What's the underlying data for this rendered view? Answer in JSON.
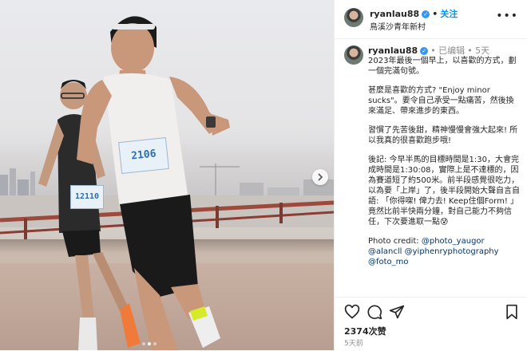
{
  "post_header": {
    "username": "ryanlau88",
    "verified_icon": "verified-badge-icon",
    "separator": "•",
    "follow_label": "关注",
    "location": "鳥溪沙青年新村",
    "more_icon": "more-options-icon"
  },
  "photo": {
    "bib_main": "2106",
    "bib_second": "12110",
    "next_icon": "chevron-right-icon",
    "carousel": {
      "count": 3,
      "active_index": 1
    }
  },
  "caption": {
    "username": "ryanlau88",
    "edited_label": "• 已编辑",
    "time": "• 5天",
    "paragraphs": [
      "2023年最後一個早上，以喜歡的方式，劃一個完滿句號。",
      "甚麼是喜歡的方式? \"Enjoy minor sucks\"。要令自己承受一點痛苦，然後換來滿足、帶來進步的東西。",
      "習慣了先苦後甜，精神慢慢會強大起來! 所以我真的很喜歡跑步哦!",
      "後記: 今早半馬的目標時間是1:30，大會完成時間是1:30:08，實際上是不達標的，因為賽道短了約500米。前半段感覺很吃力，以為要「上岸」了，後半段開始大聲自言自語: 「你得㗎! 俾力去! Keep住個Form! 」竟然比前半快兩分鐘，對自己能力不夠信任，下次要進取一點😰"
    ],
    "credit_prefix": "Photo credit: ",
    "credits": [
      "@photo_yaugor",
      "@alancll",
      "@yiphenryphotography",
      "@foto_mo"
    ]
  },
  "actions": {
    "like_icon": "heart-icon",
    "comment_icon": "comment-icon",
    "share_icon": "share-icon",
    "save_icon": "bookmark-icon",
    "likes_label": "2374次赞",
    "timestamp": "5天前"
  },
  "colors": {
    "link": "#00376b",
    "follow": "#0095f6",
    "verified": "#3897f0",
    "muted": "#8e8e8e"
  }
}
